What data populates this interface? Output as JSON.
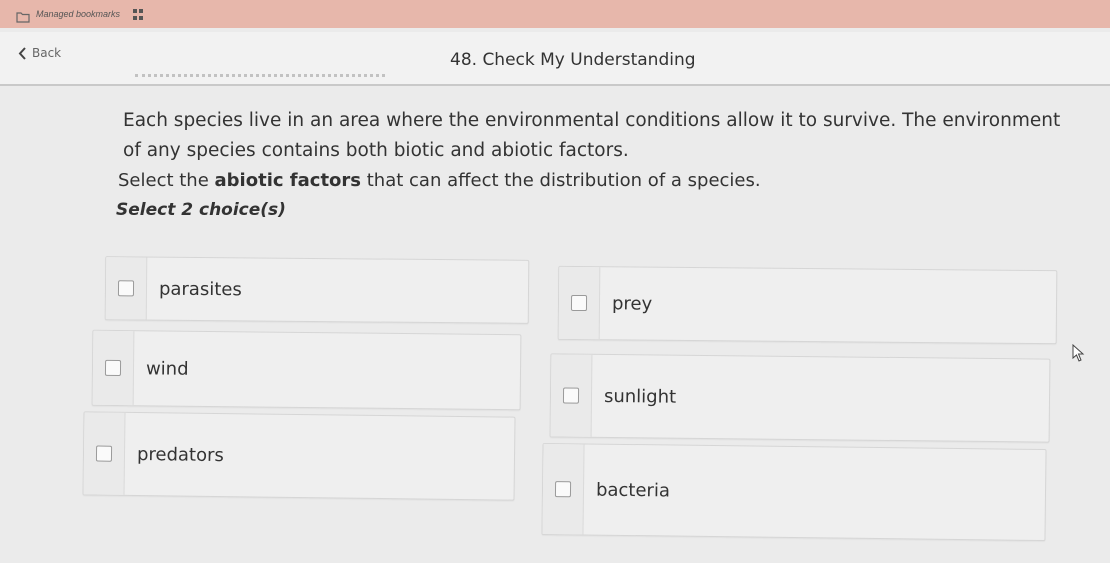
{
  "bookmarks_bar": {
    "label": "Managed bookmarks"
  },
  "header": {
    "back_label": "Back",
    "title": "48. Check My Understanding"
  },
  "question": {
    "line1": "Each species live in an area where the environmental conditions allow it to survive. The environment",
    "line2": "of any species contains both biotic and abiotic factors.",
    "select_prefix": "Select the ",
    "select_bold": "abiotic factors",
    "select_suffix": " that can affect the distribution of a species.",
    "count": "Select 2 choice(s)"
  },
  "choices": [
    {
      "label": "parasites",
      "checked": false
    },
    {
      "label": "prey",
      "checked": false
    },
    {
      "label": "wind",
      "checked": false
    },
    {
      "label": "sunlight",
      "checked": false
    },
    {
      "label": "predators",
      "checked": false
    },
    {
      "label": "bacteria",
      "checked": false
    }
  ],
  "colors": {
    "topbar": "#e7b7ab",
    "background": "#ebebeb",
    "text": "#333333"
  }
}
